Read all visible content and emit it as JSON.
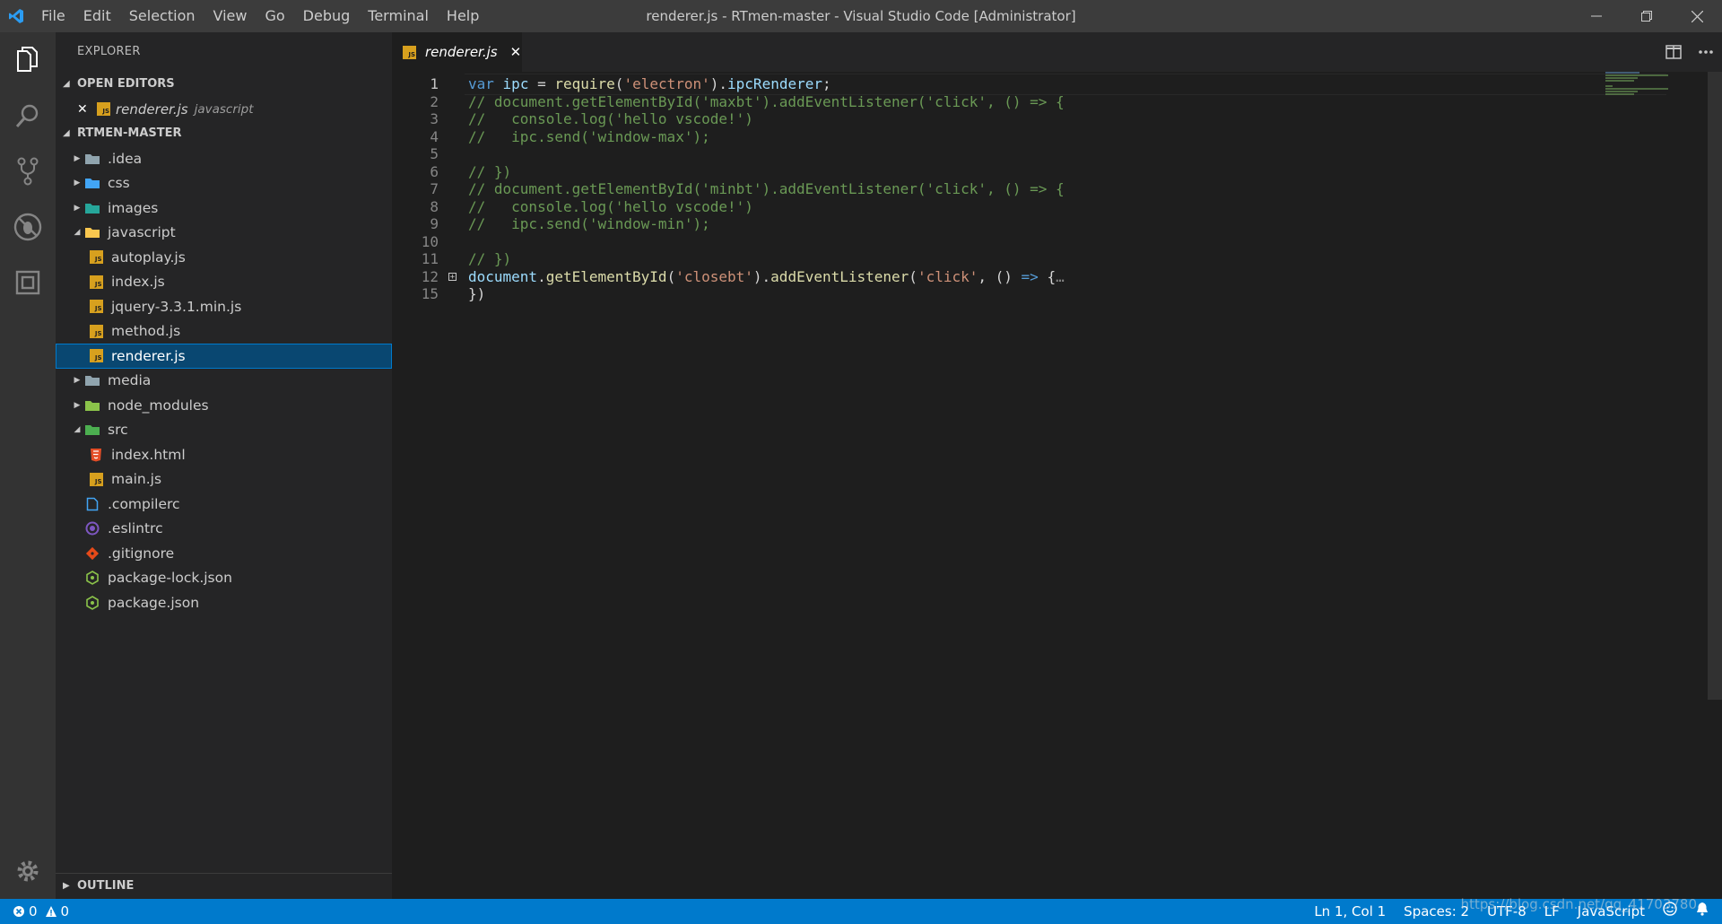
{
  "window": {
    "title": "renderer.js - RTmen-master - Visual Studio Code [Administrator]"
  },
  "menu": [
    "File",
    "Edit",
    "Selection",
    "View",
    "Go",
    "Debug",
    "Terminal",
    "Help"
  ],
  "sidebar": {
    "header": "EXPLORER",
    "open_editors": {
      "title": "OPEN EDITORS",
      "items": [
        {
          "name": "renderer.js",
          "desc": "javascript"
        }
      ]
    },
    "project": {
      "title": "RTMEN-MASTER",
      "items": [
        {
          "label": ".idea",
          "kind": "folder",
          "icon": "folder-icon",
          "color": "#90a4ae",
          "level": 0,
          "twisty": "closed"
        },
        {
          "label": "css",
          "kind": "folder",
          "icon": "folder-css-icon",
          "color": "#42a5f5",
          "level": 0,
          "twisty": "closed"
        },
        {
          "label": "images",
          "kind": "folder",
          "icon": "folder-images-icon",
          "color": "#26a69a",
          "level": 0,
          "twisty": "closed"
        },
        {
          "label": "javascript",
          "kind": "folder",
          "icon": "folder-open-icon",
          "color": "#f9c74f",
          "level": 0,
          "twisty": "open"
        },
        {
          "label": "autoplay.js",
          "kind": "js",
          "icon": "js-file-icon",
          "level": 1
        },
        {
          "label": "index.js",
          "kind": "js",
          "icon": "js-file-icon",
          "level": 1
        },
        {
          "label": "jquery-3.3.1.min.js",
          "kind": "js",
          "icon": "js-file-icon",
          "level": 1
        },
        {
          "label": "method.js",
          "kind": "js",
          "icon": "js-file-icon",
          "level": 1
        },
        {
          "label": "renderer.js",
          "kind": "js",
          "icon": "js-file-icon",
          "level": 1,
          "selected": true
        },
        {
          "label": "media",
          "kind": "folder",
          "icon": "folder-icon",
          "color": "#90a4ae",
          "level": 0,
          "twisty": "closed"
        },
        {
          "label": "node_modules",
          "kind": "folder",
          "icon": "folder-node-icon",
          "color": "#8bc34a",
          "level": 0,
          "twisty": "closed"
        },
        {
          "label": "src",
          "kind": "folder",
          "icon": "folder-src-open-icon",
          "color": "#4caf50",
          "level": 0,
          "twisty": "open"
        },
        {
          "label": "index.html",
          "kind": "html",
          "icon": "html5-icon",
          "color": "#e44d26",
          "level": 1
        },
        {
          "label": "main.js",
          "kind": "js",
          "icon": "js-file-icon",
          "level": 1
        },
        {
          "label": ".compilerc",
          "kind": "file",
          "icon": "file-icon",
          "color": "#42a5f5",
          "level": 0
        },
        {
          "label": ".eslintrc",
          "kind": "eslint",
          "icon": "eslint-icon",
          "color": "#7e57c2",
          "level": 0
        },
        {
          "label": ".gitignore",
          "kind": "git",
          "icon": "git-icon",
          "color": "#e64a19",
          "level": 0
        },
        {
          "label": "package-lock.json",
          "kind": "node",
          "icon": "nodejs-icon",
          "color": "#8bc34a",
          "level": 0
        },
        {
          "label": "package.json",
          "kind": "node",
          "icon": "nodejs-icon",
          "color": "#8bc34a",
          "level": 0
        }
      ]
    },
    "outline_title": "OUTLINE"
  },
  "tabs": [
    {
      "label": "renderer.js",
      "active": true
    }
  ],
  "editor": {
    "lines": [
      {
        "n": "1",
        "active": true,
        "tokens": [
          [
            "var",
            "kw"
          ],
          [
            " ",
            ""
          ],
          [
            "ipc",
            "var"
          ],
          [
            " = ",
            ""
          ],
          [
            "require",
            "fn"
          ],
          [
            "(",
            ""
          ],
          [
            "'electron'",
            "str"
          ],
          [
            ").",
            ""
          ],
          [
            "ipcRenderer",
            "var"
          ],
          [
            ";",
            ""
          ]
        ]
      },
      {
        "n": "2",
        "tokens": [
          [
            "// document.getElementById('maxbt').addEventListener('click', () => {",
            "com"
          ]
        ]
      },
      {
        "n": "3",
        "tokens": [
          [
            "//   console.log('hello vscode!')",
            "com"
          ]
        ]
      },
      {
        "n": "4",
        "tokens": [
          [
            "//   ipc.send('window-max');",
            "com"
          ]
        ]
      },
      {
        "n": "5",
        "tokens": []
      },
      {
        "n": "6",
        "tokens": [
          [
            "// })",
            "com"
          ]
        ]
      },
      {
        "n": "7",
        "tokens": [
          [
            "// document.getElementById('minbt').addEventListener('click', () => {",
            "com"
          ]
        ]
      },
      {
        "n": "8",
        "tokens": [
          [
            "//   console.log('hello vscode!')",
            "com"
          ]
        ]
      },
      {
        "n": "9",
        "tokens": [
          [
            "//   ipc.send('window-min');",
            "com"
          ]
        ]
      },
      {
        "n": "10",
        "tokens": []
      },
      {
        "n": "11",
        "tokens": [
          [
            "// })",
            "com"
          ]
        ]
      },
      {
        "n": "12",
        "folded": true,
        "tokens": [
          [
            "document",
            "var"
          ],
          [
            ".",
            ""
          ],
          [
            "getElementById",
            "fn"
          ],
          [
            "(",
            ""
          ],
          [
            "'closebt'",
            "str"
          ],
          [
            ").",
            ""
          ],
          [
            "addEventListener",
            "fn"
          ],
          [
            "(",
            ""
          ],
          [
            "'click'",
            "str"
          ],
          [
            ", () ",
            ""
          ],
          [
            "=>",
            "kw"
          ],
          [
            " {",
            ""
          ],
          [
            "…",
            "ell"
          ]
        ]
      },
      {
        "n": "15",
        "tokens": [
          [
            "})",
            ""
          ]
        ]
      }
    ]
  },
  "statusbar": {
    "errors": "0",
    "warnings": "0",
    "position": "Ln 1, Col 1",
    "spaces": "Spaces: 2",
    "encoding": "UTF-8",
    "eol": "LF",
    "language": "JavaScript",
    "watermark": "https://blog.csdn.net/qq_41703780"
  },
  "colors": {
    "accent": "#007acc",
    "selection": "#094771",
    "comment": "#6a9955",
    "keyword": "#569cd6",
    "string": "#ce9178"
  }
}
